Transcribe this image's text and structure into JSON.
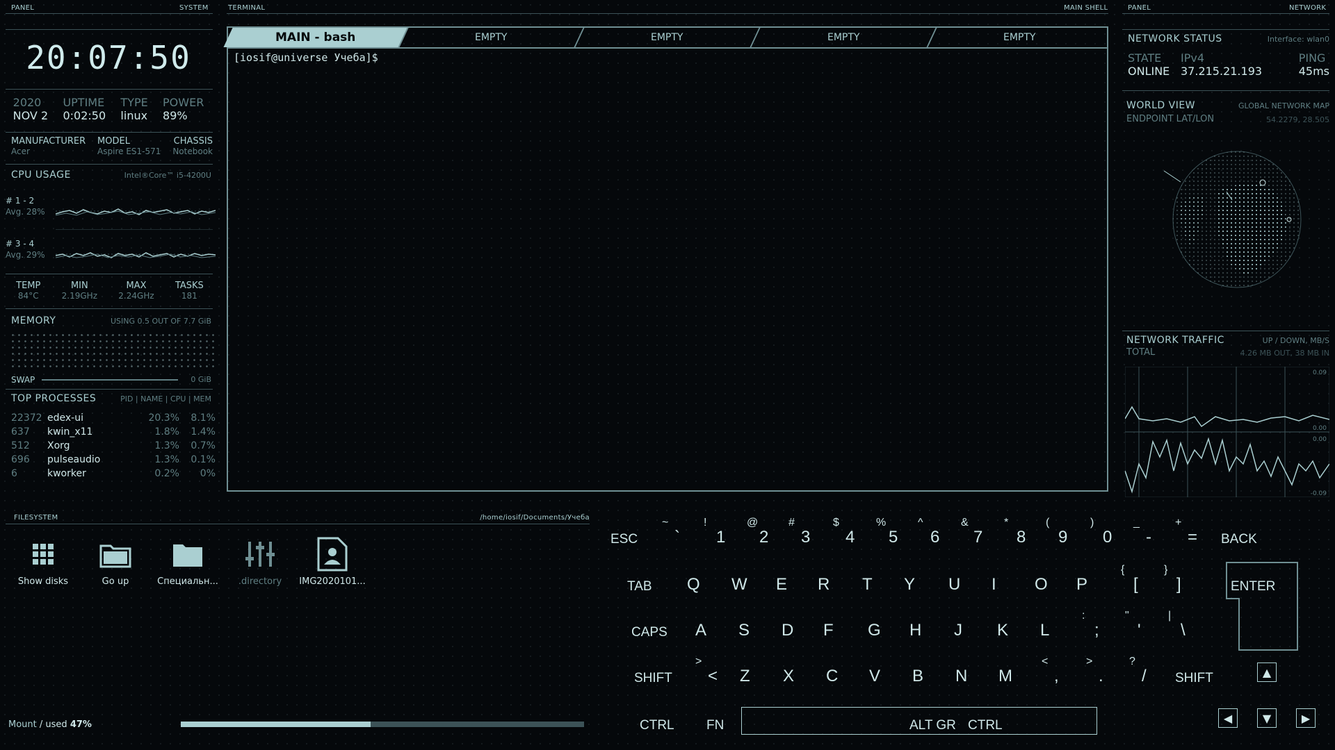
{
  "headers": {
    "panel_left": "PANEL",
    "system": "SYSTEM",
    "terminal": "TERMINAL",
    "main_shell": "MAIN SHELL",
    "panel_right": "PANEL",
    "network": "NETWORK",
    "filesystem": "FILESYSTEM",
    "fs_path": "/home/iosif/Documents/Учеба"
  },
  "clock": "20:07:50",
  "system": {
    "year": "2020",
    "date": "NOV 2",
    "uptime_label": "UPTIME",
    "uptime": "0:02:50",
    "type_label": "TYPE",
    "type": "linux",
    "power_label": "POWER",
    "power": "89%",
    "manufacturer_label": "MANUFACTURER",
    "manufacturer": "Acer",
    "model_label": "MODEL",
    "model": "Aspire ES1-571",
    "chassis_label": "CHASSIS",
    "chassis": "Notebook"
  },
  "cpu": {
    "title": "CPU USAGE",
    "model": "Intel®Core™ i5-4200U",
    "core1_label": "# 1 - 2",
    "core1_avg": "Avg. 28%",
    "core2_label": "# 3 - 4",
    "core2_avg": "Avg. 29%",
    "temp_label": "TEMP",
    "temp": "84°C",
    "min_label": "MIN",
    "min": "2.19GHz",
    "max_label": "MAX",
    "max": "2.24GHz",
    "tasks_label": "TASKS",
    "tasks": "181"
  },
  "memory": {
    "title": "MEMORY",
    "usage": "USING 0.5 OUT OF 7.7 GiB",
    "swap_label": "SWAP",
    "swap_value": "0 GiB"
  },
  "processes": {
    "title": "TOP PROCESSES",
    "columns": "PID | NAME | CPU | MEM",
    "rows": [
      {
        "pid": "22372",
        "name": "edex-ui",
        "cpu": "20.3%",
        "mem": "8.1%"
      },
      {
        "pid": "637",
        "name": "kwin_x11",
        "cpu": "1.8%",
        "mem": "1.4%"
      },
      {
        "pid": "512",
        "name": "Xorg",
        "cpu": "1.3%",
        "mem": "0.7%"
      },
      {
        "pid": "696",
        "name": "pulseaudio",
        "cpu": "1.3%",
        "mem": "0.1%"
      },
      {
        "pid": "6",
        "name": "kworker",
        "cpu": "0.2%",
        "mem": "0%"
      }
    ]
  },
  "terminal": {
    "tabs": [
      "MAIN - bash",
      "EMPTY",
      "EMPTY",
      "EMPTY",
      "EMPTY"
    ],
    "prompt": "[iosif@universe Учеба]$"
  },
  "network": {
    "status_title": "NETWORK STATUS",
    "interface": "Interface: wlan0",
    "state_label": "STATE",
    "state": "ONLINE",
    "ipv_label": "IPv4",
    "ip": "37.215.21.193",
    "ping_label": "PING",
    "ping": "45ms",
    "world_title": "WORLD VIEW",
    "world_sub": "GLOBAL NETWORK MAP",
    "endpoint_label": "ENDPOINT LAT/LON",
    "endpoint": "54.2279, 28.505",
    "traffic_title": "NETWORK TRAFFIC",
    "traffic_units": "UP / DOWN, MB/S",
    "total_label": "TOTAL",
    "total": "4.26 MB OUT, 38 MB IN",
    "tick_top": "0.09",
    "tick_mid1": "0.00",
    "tick_mid2": "0.00",
    "tick_bot": "-0.09"
  },
  "filesystem": {
    "items": [
      {
        "name": "Show disks",
        "icon": "grid-icon"
      },
      {
        "name": "Go up",
        "icon": "folder-up-icon"
      },
      {
        "name": "Специальн...",
        "icon": "folder-icon"
      },
      {
        "name": ".directory",
        "icon": "sliders-icon"
      },
      {
        "name": "IMG2020101...",
        "icon": "image-file-icon"
      }
    ],
    "mount_label": "Mount",
    "used_label": "/ used",
    "used_value": "47%",
    "used_fraction": 0.47
  },
  "keyboard": {
    "row1": [
      {
        "m": "ESC"
      },
      {
        "m": "`",
        "s": "~"
      },
      {
        "m": "1",
        "s": "!"
      },
      {
        "m": "2",
        "s": "@"
      },
      {
        "m": "3",
        "s": "#"
      },
      {
        "m": "4",
        "s": "$"
      },
      {
        "m": "5",
        "s": "%"
      },
      {
        "m": "6",
        "s": "^"
      },
      {
        "m": "7",
        "s": "&"
      },
      {
        "m": "8",
        "s": "*"
      },
      {
        "m": "9",
        "s": "("
      },
      {
        "m": "0",
        "s": ")"
      },
      {
        "m": "-",
        "s": "_"
      },
      {
        "m": "=",
        "s": "+"
      },
      {
        "m": "BACK"
      }
    ],
    "row2": [
      {
        "m": "TAB"
      },
      {
        "m": "Q"
      },
      {
        "m": "W"
      },
      {
        "m": "E"
      },
      {
        "m": "R"
      },
      {
        "m": "T"
      },
      {
        "m": "Y"
      },
      {
        "m": "U"
      },
      {
        "m": "I"
      },
      {
        "m": "O"
      },
      {
        "m": "P"
      },
      {
        "m": "[",
        "s": "{"
      },
      {
        "m": "]",
        "s": "}"
      },
      {
        "m": "ENTER"
      }
    ],
    "row3": [
      {
        "m": "CAPS"
      },
      {
        "m": "A"
      },
      {
        "m": "S"
      },
      {
        "m": "D"
      },
      {
        "m": "F"
      },
      {
        "m": "G"
      },
      {
        "m": "H"
      },
      {
        "m": "J"
      },
      {
        "m": "K"
      },
      {
        "m": "L"
      },
      {
        "m": ";",
        "s": ":"
      },
      {
        "m": "'",
        "s": "\""
      },
      {
        "m": "\\",
        "s": "|"
      }
    ],
    "row4": [
      {
        "m": "SHIFT"
      },
      {
        "m": "<",
        "s": ">"
      },
      {
        "m": "Z"
      },
      {
        "m": "X"
      },
      {
        "m": "C"
      },
      {
        "m": "V"
      },
      {
        "m": "B"
      },
      {
        "m": "N"
      },
      {
        "m": "M"
      },
      {
        "m": ",",
        "s": "<"
      },
      {
        "m": ".",
        "s": ">"
      },
      {
        "m": "/",
        "s": "?"
      },
      {
        "m": "SHIFT"
      }
    ],
    "row5": [
      {
        "m": "CTRL"
      },
      {
        "m": "FN"
      },
      {
        "m": "ALT GR"
      },
      {
        "m": "CTRL"
      }
    ],
    "arrows": {
      "up": "▲",
      "left": "◀",
      "down": "▼",
      "right": "▶"
    }
  }
}
